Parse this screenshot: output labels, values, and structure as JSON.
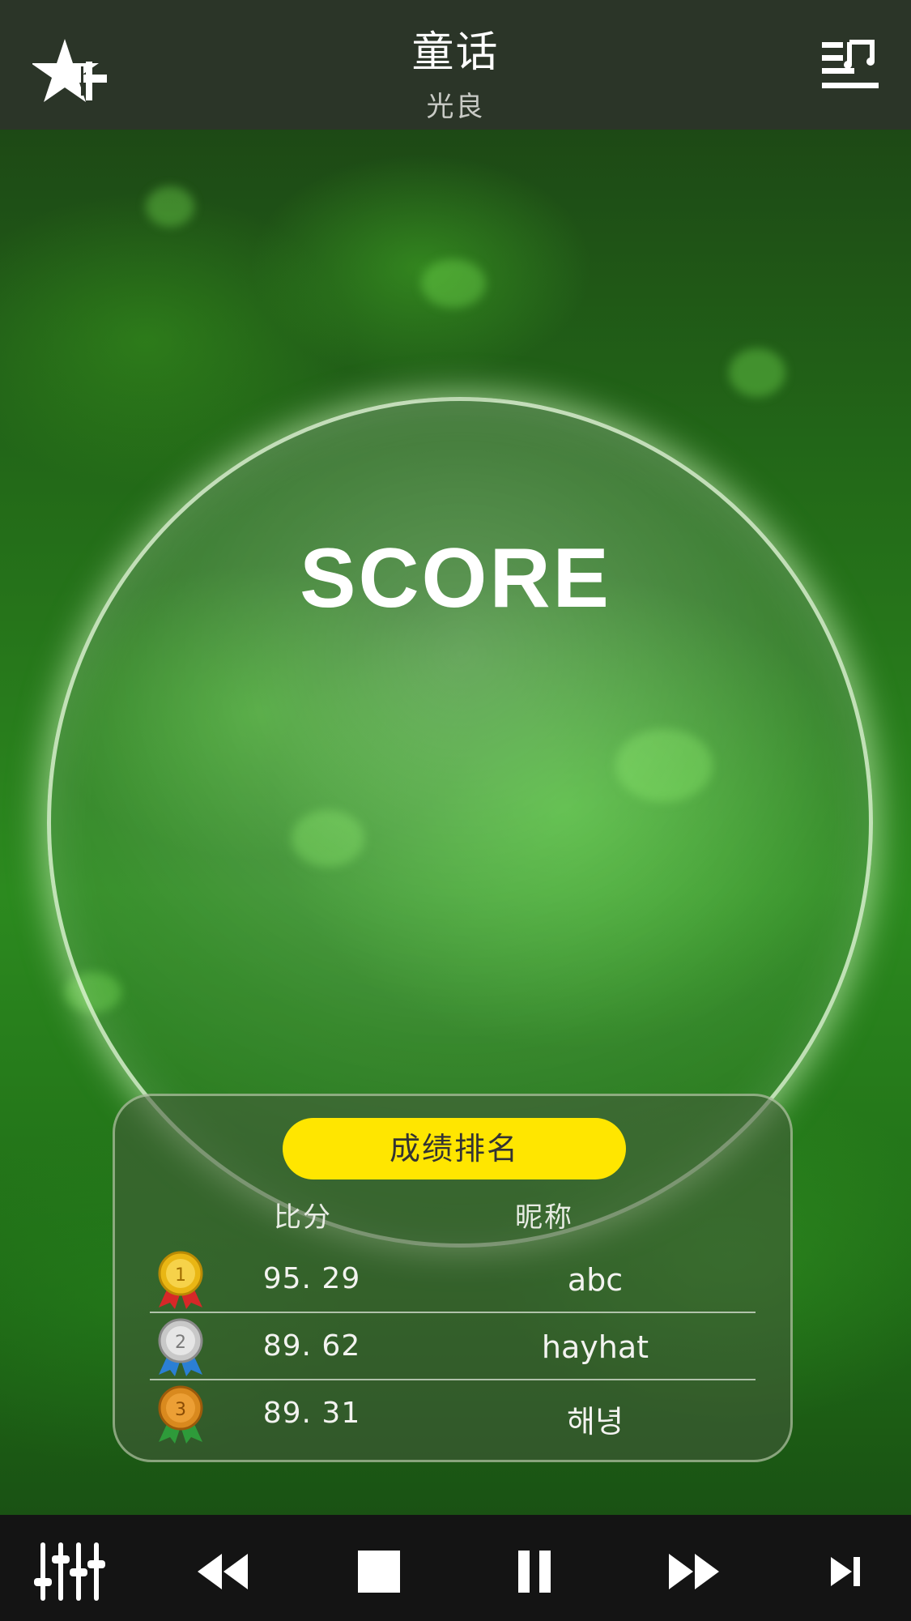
{
  "header": {
    "title": "童话",
    "subtitle": "光良",
    "left_icon": "star-plus-icon",
    "right_icon": "playlist-icon"
  },
  "main": {
    "score_label": "SCORE"
  },
  "ranking": {
    "badge_label": "成绩排名",
    "columns": {
      "score": "比分",
      "nickname": "昵称"
    },
    "rows": [
      {
        "rank": 1,
        "score": "95. 29",
        "nickname": "abc",
        "medal": "gold"
      },
      {
        "rank": 2,
        "score": "89. 62",
        "nickname": "hayhat",
        "medal": "silver"
      },
      {
        "rank": 3,
        "score": "89. 31",
        "nickname": "해녕",
        "medal": "bronze"
      }
    ]
  },
  "controls": {
    "buttons": [
      "equalizer-icon",
      "rewind-icon",
      "stop-icon",
      "pause-icon",
      "fast-forward-icon",
      "skip-next-icon"
    ]
  },
  "colors": {
    "badge": "#ffe600",
    "header_bg": "#2d342a",
    "controls_bg": "#141414"
  }
}
